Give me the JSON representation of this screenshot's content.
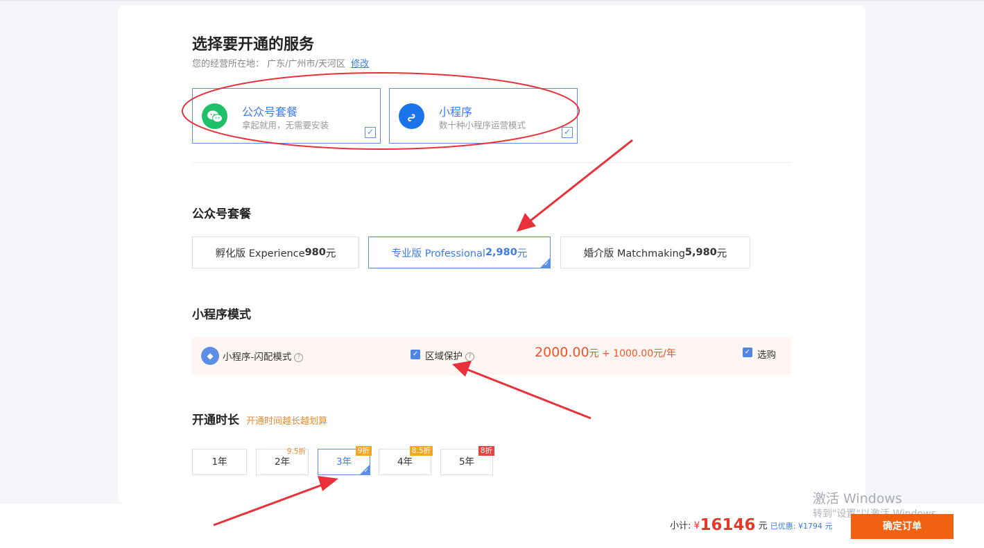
{
  "page": {
    "title": "选择要开通的服务",
    "location_label": "您的经营所在地：",
    "location_value": "广东/广州市/天河区",
    "location_edit": "修改"
  },
  "services": [
    {
      "name": "公众号套餐",
      "desc": "拿起就用，无需要安装",
      "icon": "wechat-icon",
      "checked": true,
      "color": "#20c06b"
    },
    {
      "name": "小程序",
      "desc": "数十种小程序运营模式",
      "icon": "mini-program-icon",
      "checked": true,
      "color": "#1a73e8"
    }
  ],
  "plans_section": {
    "title": "公众号套餐",
    "plans": [
      {
        "name": "孵化版 Experience ",
        "price": "980",
        "unit": "元",
        "selected": false
      },
      {
        "name": "专业版 Professional ",
        "price": "2,980",
        "unit": "元",
        "selected": true
      },
      {
        "name": "婚介版 Matchmaking ",
        "price": "5,980",
        "unit": "元",
        "selected": false
      }
    ]
  },
  "mini_program": {
    "title": "小程序模式",
    "mode_name": "小程序-闪配模式",
    "region_label": "区域保护",
    "price_main": "2000.00",
    "price_main_unit": "元",
    "price_plus": " + 1000.00元/年",
    "purchase_label": "选购",
    "region_checked": true,
    "purchase_checked": true
  },
  "duration": {
    "title": "开通时长",
    "tip": "开通时间越长越划算",
    "options": [
      {
        "label": "1年",
        "badge": "",
        "selected": false
      },
      {
        "label": "2年",
        "badge": "9.5折",
        "selected": false
      },
      {
        "label": "3年",
        "badge": "9折",
        "selected": true
      },
      {
        "label": "4年",
        "badge": "8.5折",
        "selected": false
      },
      {
        "label": "5年",
        "badge": "8折",
        "selected": false
      }
    ]
  },
  "footer": {
    "subtotal_label": "小计:",
    "currency": "¥",
    "amount": "16146",
    "amount_unit": "元",
    "discount": "已优惠: ¥1794 元",
    "confirm_label": "确定订单"
  },
  "watermark": {
    "line1": "激活 Windows",
    "line2": "转到\"设置\"以激活 Windows。"
  },
  "colors": {
    "accent": "#3d7ce8",
    "price": "#f0552b",
    "confirm": "#f06212",
    "annotation": "#e8313a"
  }
}
